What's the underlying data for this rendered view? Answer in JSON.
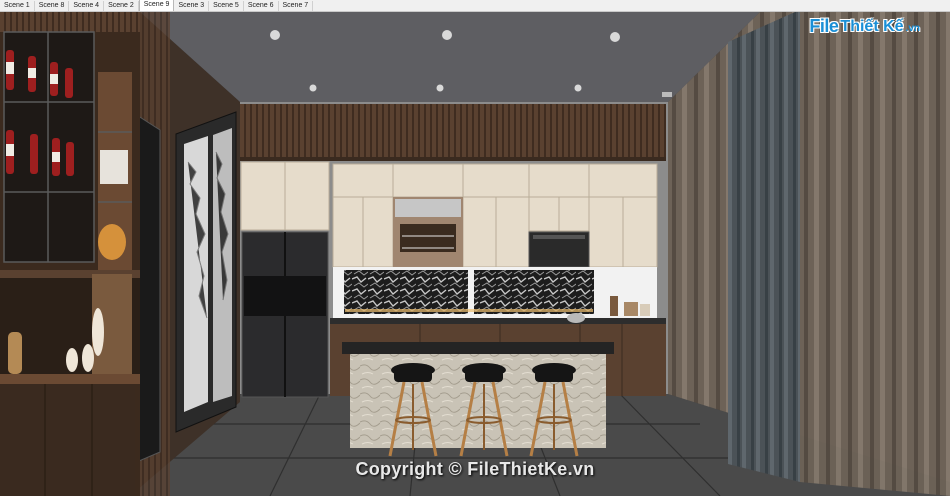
{
  "scene_tabs": [
    {
      "label": "Scene 1",
      "active": false
    },
    {
      "label": "Scene 8",
      "active": false
    },
    {
      "label": "Scene 4",
      "active": false
    },
    {
      "label": "Scene 2",
      "active": false
    },
    {
      "label": "Scene 9",
      "active": true
    },
    {
      "label": "Scene 3",
      "active": false
    },
    {
      "label": "Scene 5",
      "active": false
    },
    {
      "label": "Scene 6",
      "active": false
    },
    {
      "label": "Scene 7",
      "active": false
    }
  ],
  "watermark": {
    "logo_file": "File",
    "logo_rest": "Thiết Kế",
    "logo_vn": ".vn",
    "copyright": "Copyright © FileThietKe.vn"
  },
  "colors": {
    "wood": "#5a4130",
    "cabinet": "#e6dccb",
    "ceiling": "#5e5e62",
    "floor": "#4a4a4a",
    "curtain": "#6d6257",
    "curtain_dark": "#4b5257",
    "accent": "#1a8fd6"
  }
}
